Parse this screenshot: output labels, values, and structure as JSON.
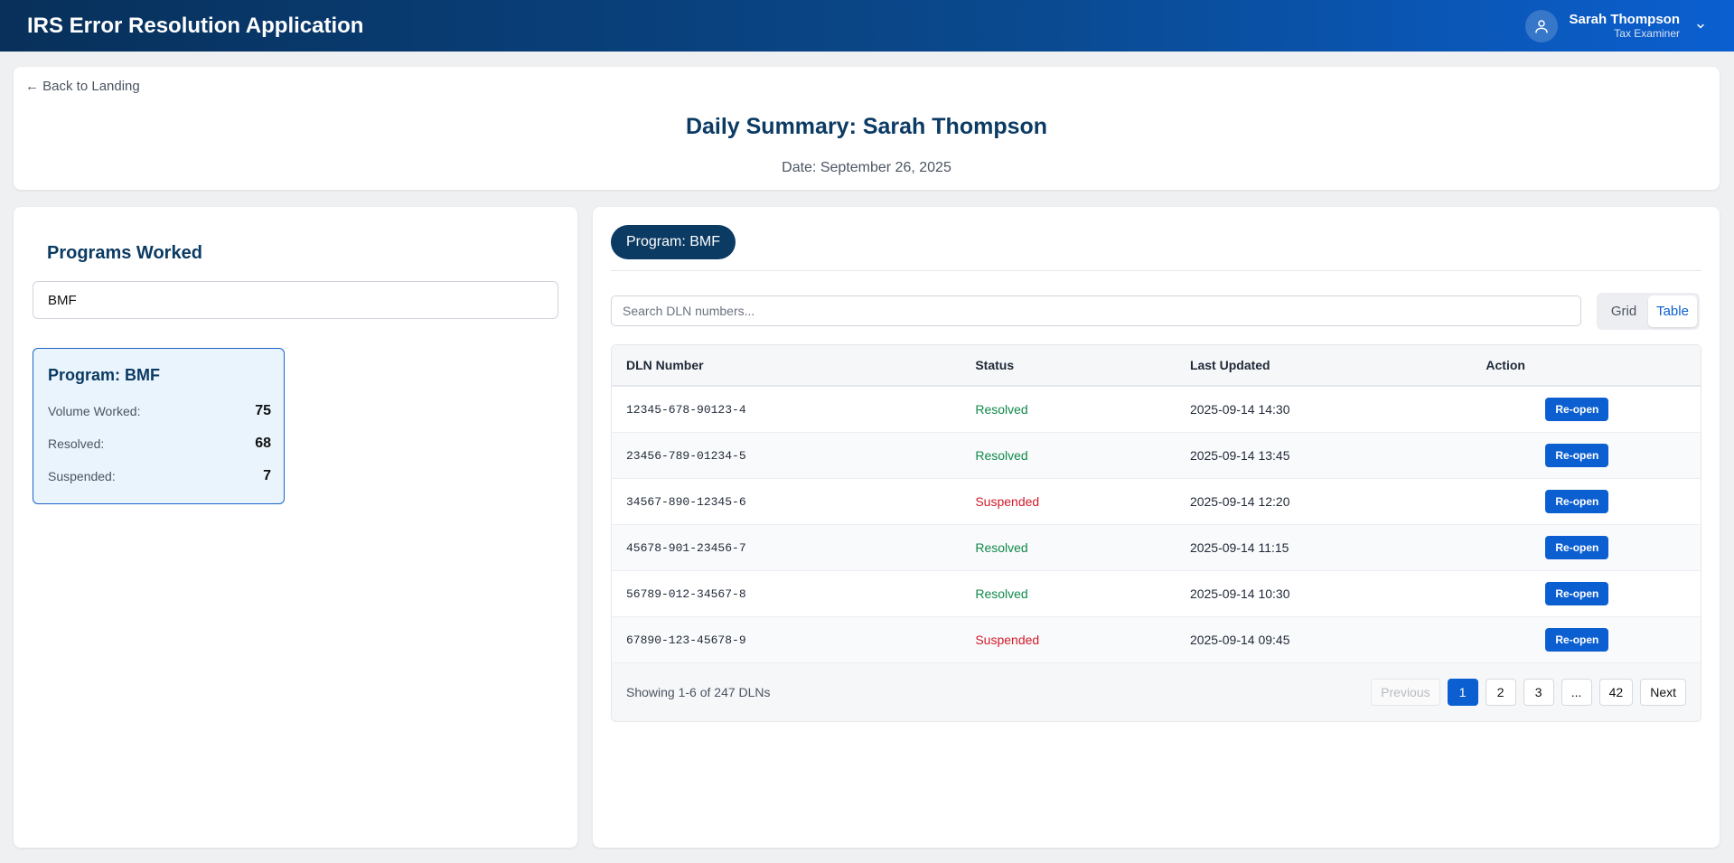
{
  "header": {
    "app_title": "IRS Error Resolution Application",
    "user_name": "Sarah Thompson",
    "user_role": "Tax Examiner"
  },
  "summary": {
    "back_link": "← Back to Landing",
    "title": "Daily Summary: Sarah Thompson",
    "date": "Date: September 26, 2025"
  },
  "programs": {
    "heading": "Programs Worked",
    "selected": "BMF",
    "card": {
      "title": "Program: BMF",
      "stats": [
        {
          "label": "Volume Worked:",
          "value": "75"
        },
        {
          "label": "Resolved:",
          "value": "68"
        },
        {
          "label": "Suspended:",
          "value": "7"
        }
      ]
    }
  },
  "detail": {
    "program_pill": "Program: BMF",
    "search_placeholder": "Search DLN numbers...",
    "view_options": [
      "Grid",
      "Table"
    ],
    "active_view": "Table",
    "columns": [
      "DLN Number",
      "Status",
      "Last Updated",
      "Action"
    ],
    "rows": [
      {
        "dln": "12345-678-90123-4",
        "status": "Resolved",
        "updated": "2025-09-14 14:30",
        "action": "Re-open"
      },
      {
        "dln": "23456-789-01234-5",
        "status": "Resolved",
        "updated": "2025-09-14 13:45",
        "action": "Re-open"
      },
      {
        "dln": "34567-890-12345-6",
        "status": "Suspended",
        "updated": "2025-09-14 12:20",
        "action": "Re-open"
      },
      {
        "dln": "45678-901-23456-7",
        "status": "Resolved",
        "updated": "2025-09-14 11:15",
        "action": "Re-open"
      },
      {
        "dln": "56789-012-34567-8",
        "status": "Resolved",
        "updated": "2025-09-14 10:30",
        "action": "Re-open"
      },
      {
        "dln": "67890-123-45678-9",
        "status": "Suspended",
        "updated": "2025-09-14 09:45",
        "action": "Re-open"
      }
    ],
    "showing": "Showing 1-6 of 247 DLNs",
    "pagination": {
      "previous": "Previous",
      "pages": [
        "1",
        "2",
        "3",
        "...",
        "42"
      ],
      "active_page": "1",
      "next": "Next"
    }
  },
  "colors": {
    "brand_dark": "#0b3a63",
    "accent_blue": "#0b5fd0",
    "resolved_green": "#0f8a4a",
    "suspended_red": "#d11a2a"
  }
}
